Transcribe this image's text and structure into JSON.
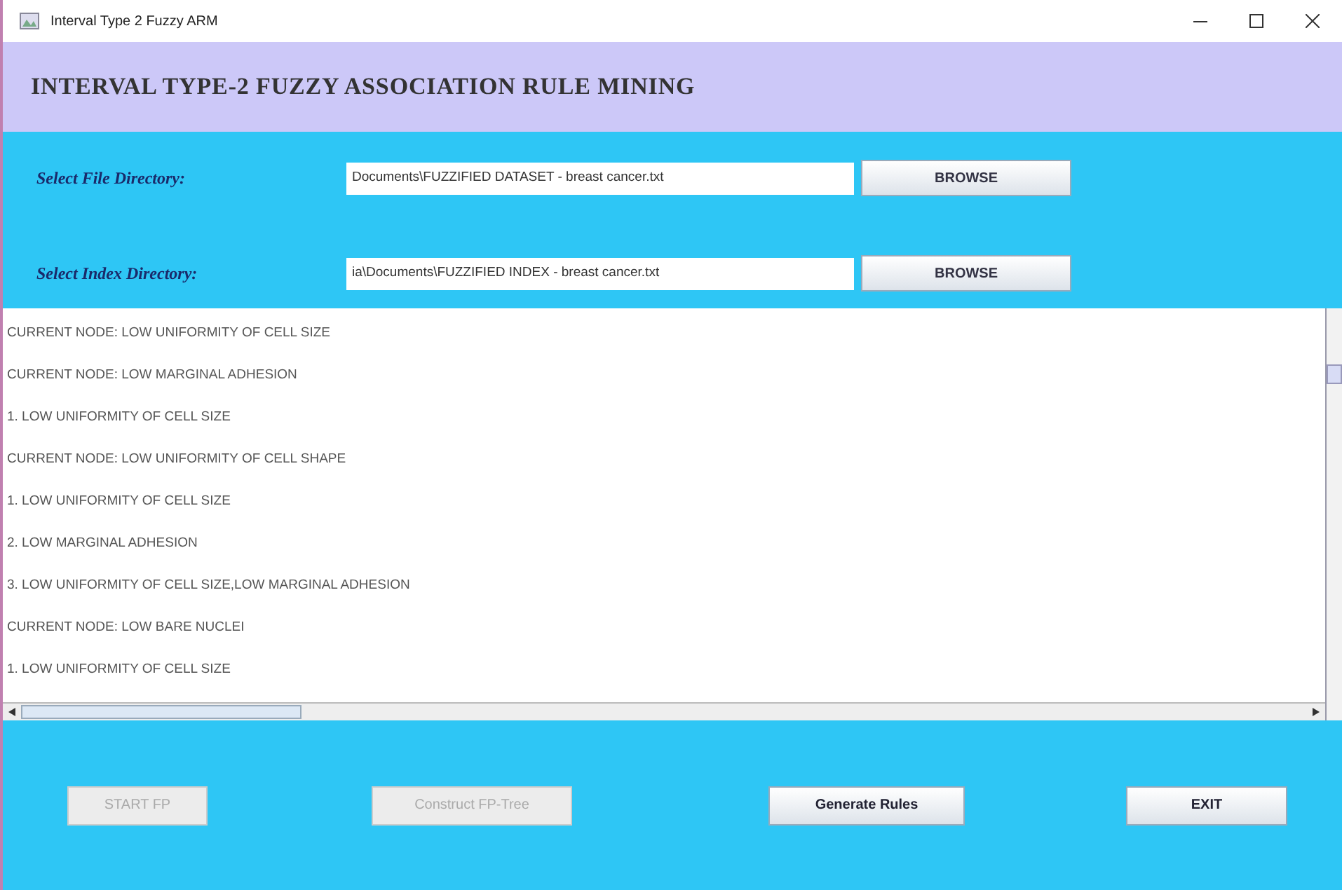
{
  "window": {
    "title": "Interval Type 2 Fuzzy ARM"
  },
  "header": {
    "title": "INTERVAL TYPE-2 FUZZY ASSOCIATION RULE MINING"
  },
  "fields": [
    {
      "label": "Select File Directory:",
      "value": "Documents\\FUZZIFIED DATASET - breast cancer.txt",
      "button": "BROWSE"
    },
    {
      "label": "Select Index Directory:",
      "value": "ia\\Documents\\FUZZIFIED INDEX - breast cancer.txt",
      "button": "BROWSE"
    }
  ],
  "output_lines": [
    "CURRENT NODE: LOW UNIFORMITY OF CELL SIZE",
    "CURRENT NODE: LOW MARGINAL ADHESION",
    "1. LOW UNIFORMITY OF CELL SIZE",
    "CURRENT NODE: LOW UNIFORMITY OF CELL SHAPE",
    "1. LOW UNIFORMITY OF CELL SIZE",
    "2. LOW MARGINAL ADHESION",
    "3. LOW UNIFORMITY OF CELL SIZE,LOW MARGINAL ADHESION",
    "CURRENT NODE: LOW BARE NUCLEI",
    "1. LOW UNIFORMITY OF CELL SIZE"
  ],
  "buttons": [
    {
      "label": "START FP",
      "disabled": true
    },
    {
      "label": "Construct FP-Tree",
      "disabled": true
    },
    {
      "label": "Generate Rules",
      "disabled": false
    },
    {
      "label": "EXIT",
      "disabled": false
    }
  ]
}
